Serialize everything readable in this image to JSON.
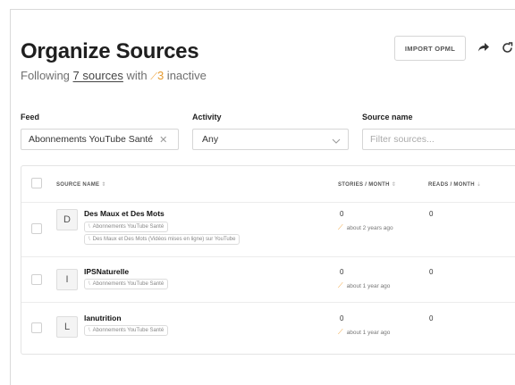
{
  "header": {
    "title": "Organize Sources",
    "subtitle": {
      "prefix": "Following ",
      "sources_link": "7 sources",
      "middle": " with ",
      "inactive_count": "3",
      "suffix": " inactive"
    },
    "import_button": "IMPORT OPML",
    "share_icon": "share-arrow-icon",
    "refresh_icon": "refresh-icon"
  },
  "filters": {
    "feed": {
      "label": "Feed",
      "value": "Abonnements YouTube Santé"
    },
    "activity": {
      "label": "Activity",
      "value": "Any"
    },
    "source_name": {
      "label": "Source name",
      "placeholder": "Filter sources..."
    }
  },
  "table": {
    "columns": {
      "source_name": "SOURCE NAME",
      "stories": "STORIES / MONTH",
      "reads": "READS / MONTH"
    },
    "rows": [
      {
        "initial": "D",
        "name": "Des Maux et Des Mots",
        "tags": [
          "Abonnements YouTube Santé",
          "Des Maux et Des Mots (Vidéos mises en ligne) sur YouTube"
        ],
        "stories": "0",
        "last": "about 2 years ago",
        "reads": "0"
      },
      {
        "initial": "I",
        "name": "IPSNaturelle",
        "tags": [
          "Abonnements YouTube Santé"
        ],
        "stories": "0",
        "last": "about 1 year ago",
        "reads": "0"
      },
      {
        "initial": "L",
        "name": "lanutrition",
        "tags": [
          "Abonnements YouTube Santé"
        ],
        "stories": "0",
        "last": "about 1 year ago",
        "reads": "0"
      }
    ]
  },
  "colors": {
    "accent_warning": "#f0a33a",
    "border": "#d9d9d9"
  }
}
